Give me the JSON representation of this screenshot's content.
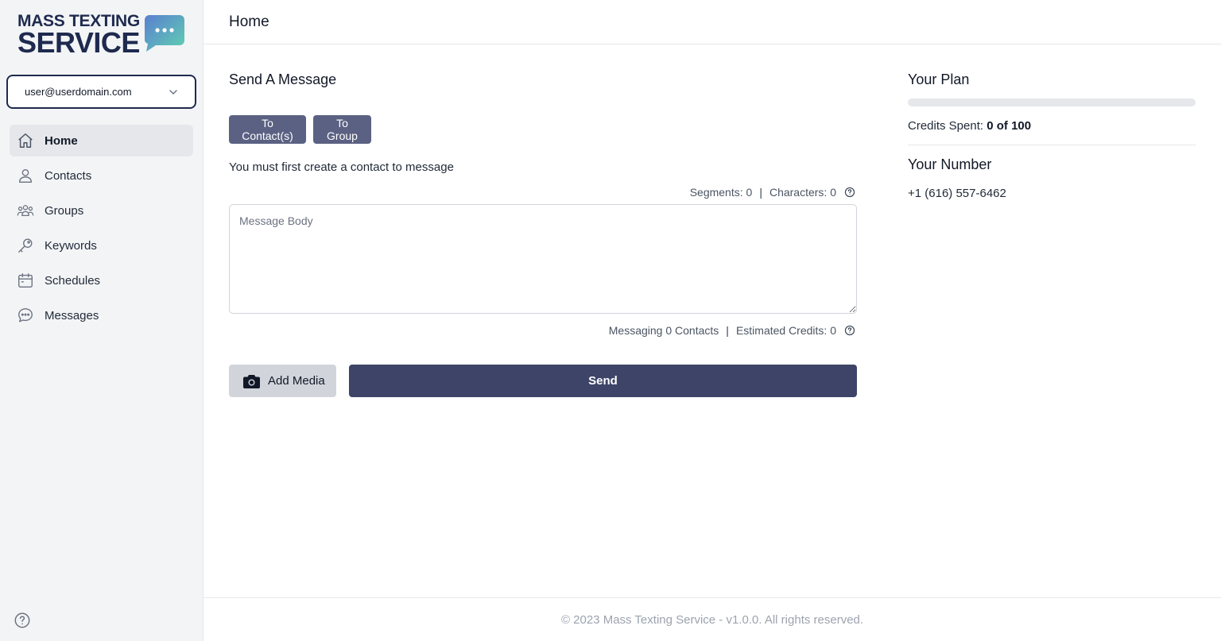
{
  "brand": {
    "line1": "MASS TEXTING",
    "line2": "SERVICE",
    "colors": {
      "navy": "#1e2a4e",
      "bubble_start": "#5b7fd1",
      "bubble_end": "#5fd1b0"
    }
  },
  "account": {
    "email": "user@userdomain.com"
  },
  "sidebar": {
    "items": [
      {
        "label": "Home",
        "icon": "home-icon",
        "active": true
      },
      {
        "label": "Contacts",
        "icon": "user-icon",
        "active": false
      },
      {
        "label": "Groups",
        "icon": "users-group-icon",
        "active": false
      },
      {
        "label": "Keywords",
        "icon": "key-icon",
        "active": false
      },
      {
        "label": "Schedules",
        "icon": "calendar-icon",
        "active": false
      },
      {
        "label": "Messages",
        "icon": "chat-icon",
        "active": false
      }
    ],
    "help_icon": "question-circle-icon"
  },
  "header": {
    "title": "Home"
  },
  "compose": {
    "title": "Send A Message",
    "tab_contacts": "To Contact(s)",
    "tab_group": "To Group",
    "notice": "You must first create a contact to message",
    "segments_label": "Segments: 0",
    "characters_label": "Characters: 0",
    "placeholder": "Message Body",
    "value": "",
    "messaging_label": "Messaging 0 Contacts",
    "estimated_label": "Estimated Credits: 0",
    "add_media": "Add Media",
    "send": "Send"
  },
  "plan": {
    "title": "Your Plan",
    "credits_prefix": "Credits Spent:",
    "credits_spent": "0",
    "credits_of": "of",
    "credits_total": "100",
    "progress_fraction": 0,
    "number_title": "Your Number",
    "number": "+1 (616) 557-6462"
  },
  "footer": {
    "text": "© 2023 Mass Texting Service - v1.0.0. All rights reserved."
  }
}
